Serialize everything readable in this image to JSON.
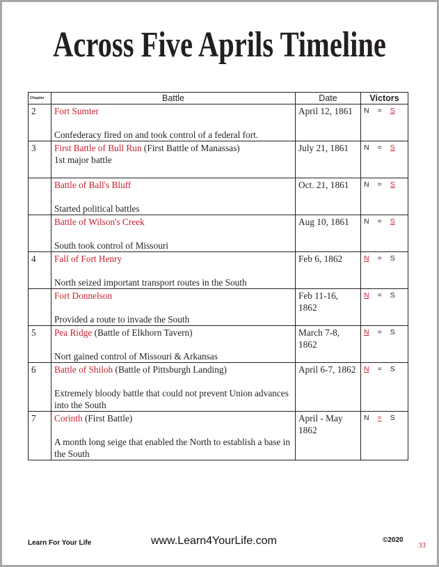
{
  "title": "Across Five Aprils Timeline",
  "table": {
    "headers": {
      "chapter": "Chapter",
      "battle": "Battle",
      "date": "Date",
      "victors": "Victors"
    },
    "victor_symbols": {
      "north": "N",
      "equal": "=",
      "south": "S"
    },
    "rows": [
      {
        "chapter": "2",
        "battle": "Fort Sumter",
        "alt_name": "",
        "note_inline": "",
        "description": "Confederacy fired on and took control of a federal fort.",
        "date": "April 12, 1861",
        "winner": "south"
      },
      {
        "chapter": "3",
        "battle": "First Battle of Bull Run",
        "alt_name": " (First Battle of Manassas)",
        "note_inline": "1st major battle",
        "description": "",
        "date": "July 21, 1861",
        "winner": "south"
      },
      {
        "chapter": "",
        "battle": "Battle of Ball's Bluff",
        "alt_name": "",
        "note_inline": "",
        "description": "Started political battles",
        "date": "Oct. 21, 1861",
        "winner": "south"
      },
      {
        "chapter": "",
        "battle": "Battle of Wilson's Creek",
        "alt_name": "",
        "note_inline": "",
        "description": "South took control of Missouri",
        "date": "Aug 10, 1861",
        "winner": "south"
      },
      {
        "chapter": "4",
        "battle": "Fall of Fort Henry",
        "alt_name": "",
        "note_inline": "",
        "description": "North seized important transport routes in the South",
        "date": "Feb 6, 1862",
        "winner": "north"
      },
      {
        "chapter": "",
        "battle": "Fort Donnelson",
        "alt_name": "",
        "note_inline": "",
        "description": "Provided a route to invade the South",
        "date": "Feb 11-16, 1862",
        "winner": "north"
      },
      {
        "chapter": "5",
        "battle": "Pea Ridge",
        "alt_name": " (Battle of Elkhorn Tavern)",
        "note_inline": "",
        "description": "Nort gained control of Missouri & Arkansas",
        "date": "March 7-8, 1862",
        "winner": "north"
      },
      {
        "chapter": "6",
        "battle": "Battle of Shiloh",
        "alt_name": " (Battle of Pittsburgh Landing)",
        "note_inline": "",
        "description": "Extremely bloody battle that could not prevent Union advances into the South",
        "date": "April 6-7, 1862",
        "winner": "north"
      },
      {
        "chapter": "7",
        "battle": "Corinth",
        "alt_name": " (First Battle)",
        "note_inline": "",
        "description": "A month long seige that enabled the North to establish a base in the South",
        "date": "April - May 1862",
        "winner": "equal"
      }
    ]
  },
  "footer": {
    "brand": "Learn For Your Life",
    "url": "www.Learn4YourLife.com",
    "copyright": "©2020",
    "page_number": "33"
  },
  "colors": {
    "accent_red": "#c8202e",
    "text": "#231f20"
  }
}
